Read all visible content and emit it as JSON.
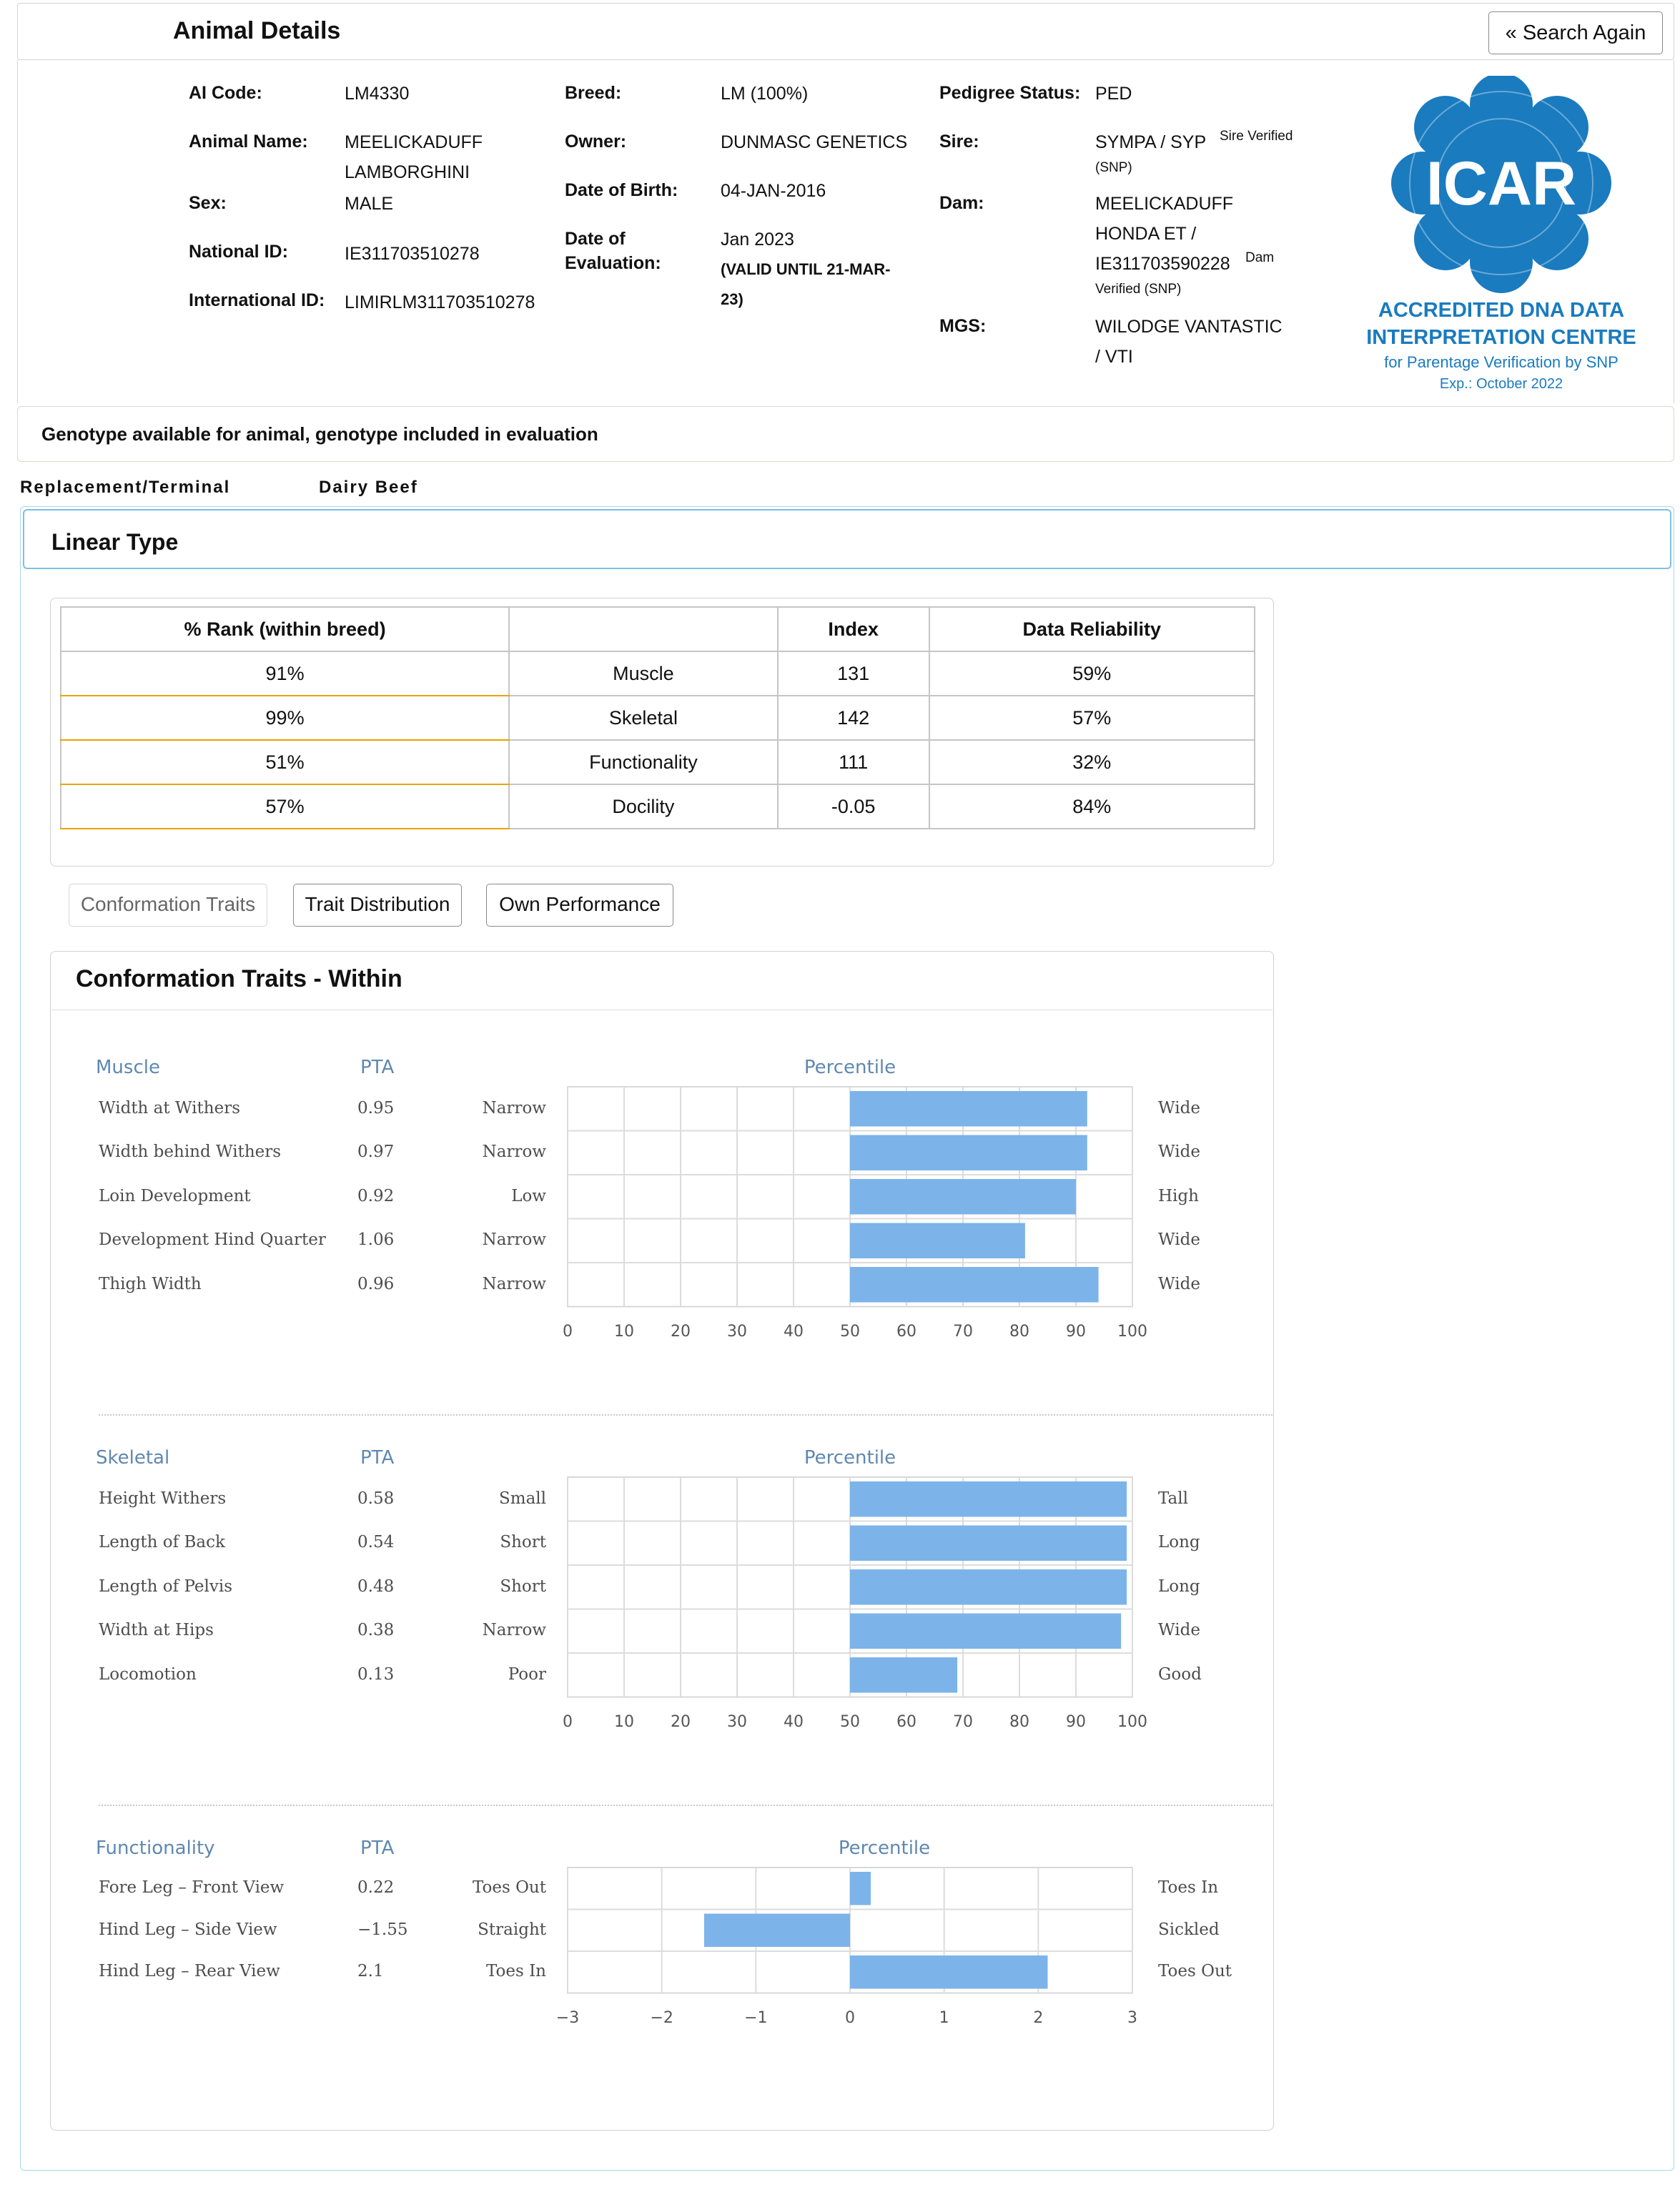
{
  "header": {
    "title": "Animal Details",
    "search_again": "« Search Again"
  },
  "details": {
    "ai_code_label": "AI Code:",
    "ai_code": "LM4330",
    "animal_name_label": "Animal Name:",
    "animal_name_1": "MEELICKADUFF",
    "animal_name_2": "LAMBORGHINI",
    "sex_label": "Sex:",
    "sex": "MALE",
    "national_id_label": "National ID:",
    "national_id": "IE311703510278",
    "international_id_label": "International ID:",
    "international_id": "LIMIRLM311703510278",
    "breed_label": "Breed:",
    "breed": "LM (100%)",
    "owner_label": "Owner:",
    "owner": "DUNMASC GENETICS",
    "dob_label": "Date of Birth:",
    "dob": "04-JAN-2016",
    "doe_label_1": "Date of",
    "doe_label_2": "Evaluation:",
    "doe": "Jan 2023",
    "doe_valid_1": "(VALID UNTIL 21-MAR-",
    "doe_valid_2": "23)",
    "pedigree_label": "Pedigree Status:",
    "pedigree": "PED",
    "sire_label": "Sire:",
    "sire": "SYMPA / SYP",
    "sire_verified": "Sire Verified",
    "sire_snp": "(SNP)",
    "dam_label": "Dam:",
    "dam_1": "MEELICKADUFF",
    "dam_2": "HONDA ET /",
    "dam_3": "IE311703590228",
    "dam_verified": "Dam",
    "dam_verified_2": "Verified (SNP)",
    "mgs_label": "MGS:",
    "mgs_1": "WILODGE VANTASTIC",
    "mgs_2": "/ VTI"
  },
  "icar": {
    "logo_text": "ICAR",
    "line1": "ACCREDITED DNA DATA",
    "line2": "INTERPRETATION CENTRE",
    "line3": "for Parentage Verification by SNP",
    "line4": "Exp.: October 2022",
    "color": "#1a7bbf"
  },
  "genotype_note": "Genotype available for animal, genotype included in evaluation",
  "tabs": [
    "Replacement/Terminal",
    "Dairy Beef"
  ],
  "linear_type": {
    "title": "Linear Type",
    "columns": [
      "% Rank (within breed)",
      "",
      "Index",
      "Data Reliability"
    ],
    "rows": [
      [
        "91%",
        "Muscle",
        "131",
        "59%"
      ],
      [
        "99%",
        "Skeletal",
        "142",
        "57%"
      ],
      [
        "51%",
        "Functionality",
        "111",
        "32%"
      ],
      [
        "57%",
        "Docility",
        "-0.05",
        "84%"
      ]
    ]
  },
  "subtabs": [
    "Conformation Traits",
    "Trait Distribution",
    "Own Performance"
  ],
  "conformation": {
    "title": "Conformation Traits - Within",
    "pta_label": "PTA",
    "percentile_label": "Percentile",
    "bar_color": "#7cb4ea"
  },
  "chart_data": [
    {
      "type": "bar",
      "orientation": "horizontal",
      "group": "Muscle",
      "categories": [
        "Width at Withers",
        "Width behind Withers",
        "Loin Development",
        "Development Hind Quarter",
        "Thigh Width"
      ],
      "pta": [
        "0.95",
        "0.97",
        "0.92",
        "1.06",
        "0.96"
      ],
      "low_labels": [
        "Narrow",
        "Narrow",
        "Low",
        "Narrow",
        "Narrow"
      ],
      "high_labels": [
        "Wide",
        "Wide",
        "High",
        "Wide",
        "Wide"
      ],
      "base": 50,
      "values": [
        92,
        92,
        90,
        81,
        94
      ],
      "xlim": [
        0,
        100
      ],
      "xticks": [
        "0",
        "10",
        "20",
        "30",
        "40",
        "50",
        "60",
        "70",
        "80",
        "90",
        "100"
      ],
      "grid": true
    },
    {
      "type": "bar",
      "orientation": "horizontal",
      "group": "Skeletal",
      "categories": [
        "Height Withers",
        "Length of Back",
        "Length of Pelvis",
        "Width at Hips",
        "Locomotion"
      ],
      "pta": [
        "0.58",
        "0.54",
        "0.48",
        "0.38",
        "0.13"
      ],
      "low_labels": [
        "Small",
        "Short",
        "Short",
        "Narrow",
        "Poor"
      ],
      "high_labels": [
        "Tall",
        "Long",
        "Long",
        "Wide",
        "Good"
      ],
      "base": 50,
      "values": [
        99,
        99,
        99,
        98,
        69
      ],
      "xlim": [
        0,
        100
      ],
      "xticks": [
        "0",
        "10",
        "20",
        "30",
        "40",
        "50",
        "60",
        "70",
        "80",
        "90",
        "100"
      ],
      "grid": true
    },
    {
      "type": "bar",
      "orientation": "horizontal",
      "group": "Functionality",
      "categories": [
        "Fore Leg – Front View",
        "Hind Leg – Side View",
        "Hind Leg – Rear View"
      ],
      "pta": [
        "0.22",
        "−1.55",
        "2.1"
      ],
      "low_labels": [
        "Toes Out",
        "Straight",
        "Toes In"
      ],
      "high_labels": [
        "Toes In",
        "Sickled",
        "Toes Out"
      ],
      "base": 0,
      "values": [
        0.22,
        -1.55,
        2.1
      ],
      "xlim": [
        -3,
        3
      ],
      "xticks": [
        "−3",
        "−2",
        "−1",
        "0",
        "1",
        "2",
        "3"
      ],
      "grid": true
    }
  ]
}
